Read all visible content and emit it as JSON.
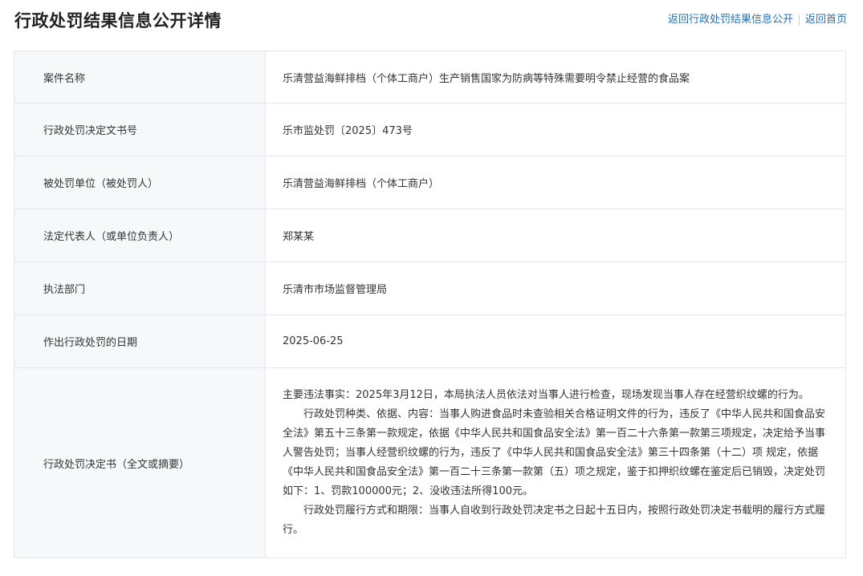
{
  "page": {
    "title": "行政处罚结果信息公开详情",
    "links": [
      {
        "label": "返回行政处罚结果信息公开"
      },
      {
        "label": "返回首页"
      }
    ]
  },
  "rows": [
    {
      "label": "案件名称",
      "value": "乐清营益海鲜排档（个体工商户）生产销售国家为防病等特殊需要明令禁止经营的食品案"
    },
    {
      "label": "行政处罚决定文书号",
      "value": "乐市监处罚〔2025〕473号"
    },
    {
      "label": "被处罚单位（被处罚人）",
      "value": "乐清营益海鲜排档（个体工商户）"
    },
    {
      "label": "法定代表人（或单位负责人）",
      "value": "郑某某"
    },
    {
      "label": "执法部门",
      "value": "乐清市市场监督管理局"
    },
    {
      "label": "作出行政处罚的日期",
      "value": "2025-06-25"
    }
  ],
  "decision": {
    "label": "行政处罚决定书（全文或摘要）",
    "paragraphs": [
      "主要违法事实：2025年3月12日，本局执法人员依法对当事人进行检查，现场发现当事人存在经营织纹螺的行为。",
      "行政处罚种类、依据、内容：当事人购进食品时未查验相关合格证明文件的行为，违反了《中华人民共和国食品安全法》第五十三条第一款规定，依据《中华人民共和国食品安全法》第一百二十六条第一款第三项规定，决定给予当事人警告处罚；当事人经营织纹螺的行为，违反了《中华人民共和国食品安全法》第三十四条第（十二）项 规定，依据《中华人民共和国食品安全法》第一百二十三条第一款第（五）项之规定，鉴于扣押织纹螺在鉴定后已销毁，决定处罚如下：1、罚款100000元；2、没收违法所得100元。",
      "行政处罚履行方式和期限：当事人自收到行政处罚决定书之日起十五日内，按照行政处罚决定书载明的履行方式履行。"
    ]
  }
}
